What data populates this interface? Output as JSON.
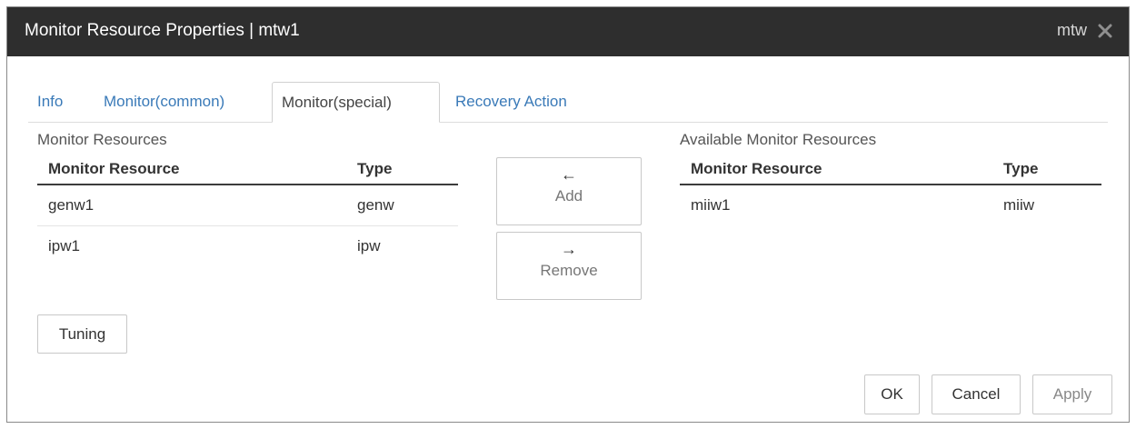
{
  "window": {
    "title": "Monitor Resource Properties | mtw1",
    "user": "mtw",
    "close_icon": "close-icon"
  },
  "tabs": [
    {
      "label": "Info",
      "active": false
    },
    {
      "label": "Monitor(common)",
      "active": false
    },
    {
      "label": "Monitor(special)",
      "active": true
    },
    {
      "label": "Recovery Action",
      "active": false
    }
  ],
  "monitor_resources": {
    "label": "Monitor Resources",
    "columns": [
      "Monitor Resource",
      "Type"
    ],
    "rows": [
      {
        "name": "genw1",
        "type": "genw"
      },
      {
        "name": "ipw1",
        "type": "ipw"
      }
    ]
  },
  "available_resources": {
    "label": "Available Monitor Resources",
    "columns": [
      "Monitor Resource",
      "Type"
    ],
    "rows": [
      {
        "name": "miiw1",
        "type": "miiw"
      }
    ]
  },
  "move_buttons": {
    "add": {
      "icon": "arrow-left-icon",
      "glyph": "←",
      "label": "Add"
    },
    "remove": {
      "icon": "arrow-right-icon",
      "glyph": "→",
      "label": "Remove"
    }
  },
  "buttons": {
    "tuning": "Tuning",
    "ok": "OK",
    "cancel": "Cancel",
    "apply": "Apply"
  }
}
